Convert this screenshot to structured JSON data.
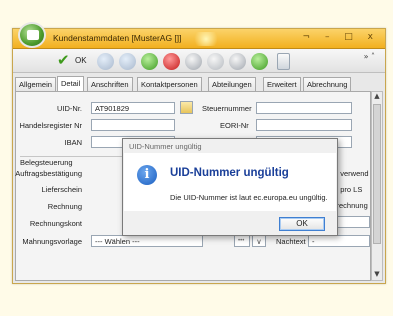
{
  "window": {
    "title": "Kundenstammdaten [MusterAG []]",
    "controls": "¬ – □ x"
  },
  "toolbar": {
    "ok_label": "OK",
    "more": "» ˄"
  },
  "tabs": [
    {
      "label": "Allgemein"
    },
    {
      "label": "Detail"
    },
    {
      "label": "Anschriften"
    },
    {
      "label": "Kontaktpersonen"
    },
    {
      "label": "Abteilungen"
    },
    {
      "label": "Erweitert"
    },
    {
      "label": "Abrechnung"
    }
  ],
  "form": {
    "uid_label": "UID-Nr.",
    "uid_value": "AT901829",
    "steuernummer_label": "Steuernummer",
    "handelsregister_label": "Handelsregister Nr",
    "eori_label": "EORI-Nr",
    "iban_label": "IBAN",
    "belegsteuerung_label": "Belegsteuerung",
    "auftrag_label": "Auftragsbestätigung",
    "lieferschein_label": "Lieferschein",
    "rechnung_label": "Rechnung",
    "rechnungskonto_label": "Rechnungskont",
    "right_fragment_1": "e verwend",
    "right_fragment_2": "g pro LS",
    "right_fragment_3": "rrechnung",
    "mahnung_label": "Mahnungsvorlage",
    "mahnung_value": "--- Wählen ---",
    "mahnung_dots": "•••",
    "mahnung_chevron": "∨",
    "nachtext_label": "Nachtext",
    "nachtext_value": "-"
  },
  "dialog": {
    "title": "UID-Nummer ungültig",
    "heading": "UID-Nummer ungültig",
    "message": "Die UID-Nummer ist laut ec.europa.eu ungültig.",
    "ok_label": "OK"
  }
}
